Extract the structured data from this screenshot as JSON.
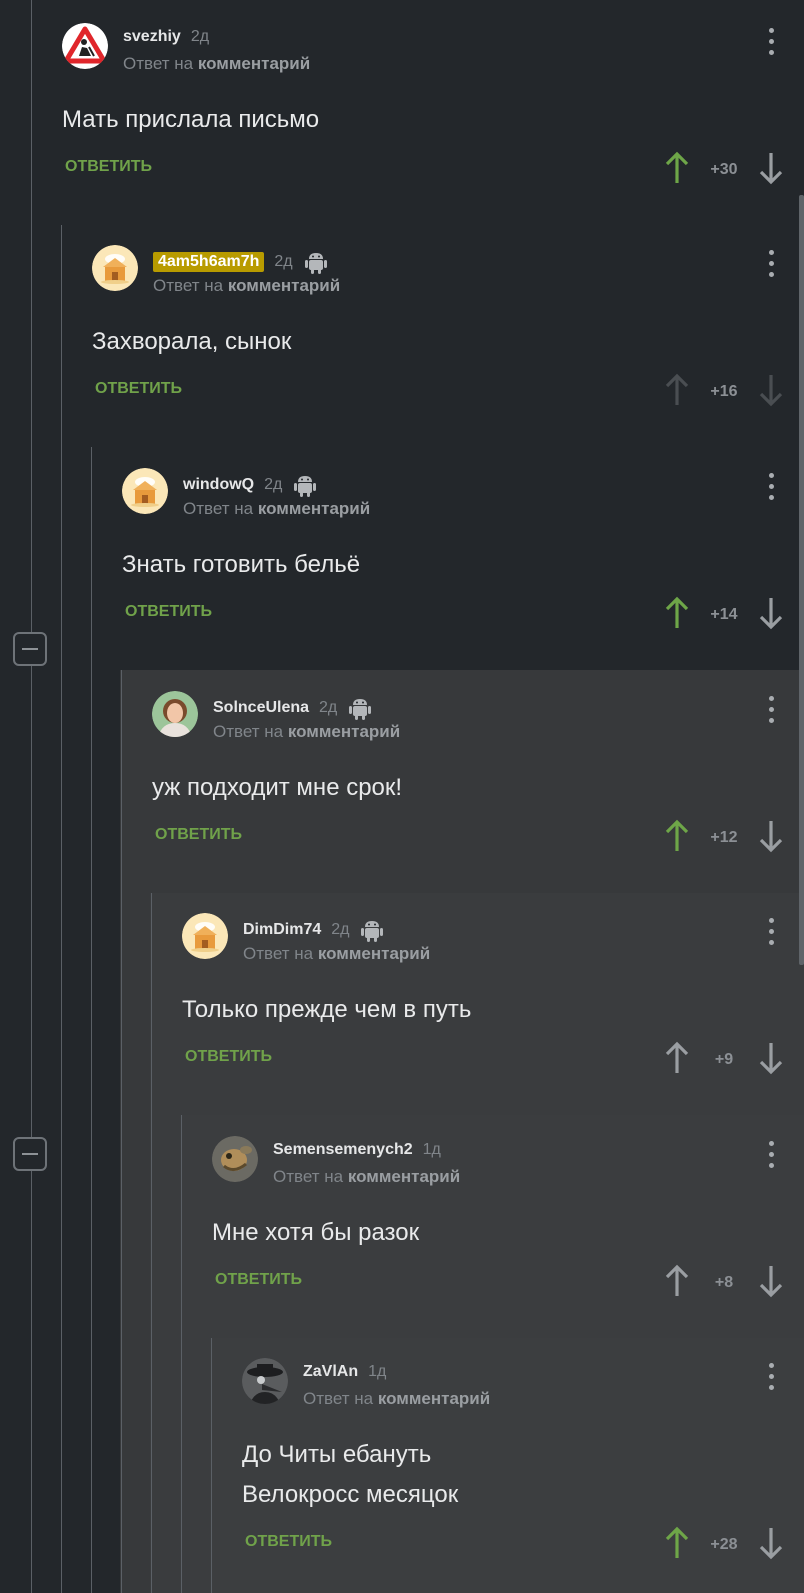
{
  "reply_prefix": "Ответ на ",
  "reply_target": "комментарий",
  "reply_label": "ОТВЕТИТЬ",
  "colors": {
    "background": "#23272b",
    "nested_background": "#37393b",
    "upvote_active": "#6ea648",
    "upvote_inactive": "#9a9ea2",
    "reply_link": "#70a24a",
    "username_highlight": "#b89b00"
  },
  "comments": [
    {
      "username": "svezhiy",
      "time": "2д",
      "android": false,
      "avatar": "road-work-sign",
      "lines": [
        "Мать прислала письмо"
      ],
      "score": "+30",
      "upvoted": true,
      "dimmed_votes": false
    },
    {
      "username": "4am5h6am7h",
      "username_highlighted": true,
      "time": "2д",
      "android": true,
      "avatar": "default-house",
      "lines": [
        "Захворала, сынок"
      ],
      "score": "+16",
      "upvoted": false,
      "dimmed_votes": true
    },
    {
      "username": "windowQ",
      "time": "2д",
      "android": true,
      "avatar": "default-house",
      "lines": [
        "Знать готовить бельё"
      ],
      "score": "+14",
      "upvoted": true,
      "dimmed_votes": false
    },
    {
      "username": "SolnceUlena",
      "time": "2д",
      "android": true,
      "avatar": "photo-woman",
      "lines": [
        "уж подходит мне срок!"
      ],
      "score": "+12",
      "upvoted": true,
      "dimmed_votes": false
    },
    {
      "username": "DimDim74",
      "time": "2д",
      "android": true,
      "avatar": "default-house",
      "lines": [
        "Только прежде чем в путь"
      ],
      "score": "+9",
      "upvoted": false,
      "dimmed_votes": false
    },
    {
      "username": "Semensemenych2",
      "time": "1д",
      "android": false,
      "avatar": "photo-lizard",
      "lines": [
        "Мне хотя бы разок"
      ],
      "score": "+8",
      "upvoted": false,
      "dimmed_votes": false
    },
    {
      "username": "ZaVlAn",
      "time": "1д",
      "android": false,
      "avatar": "photo-plague-doctor",
      "lines": [
        "До Читы ебануть",
        "Велокросс месяцок"
      ],
      "score": "+28",
      "upvoted": true,
      "dimmed_votes": false
    }
  ]
}
